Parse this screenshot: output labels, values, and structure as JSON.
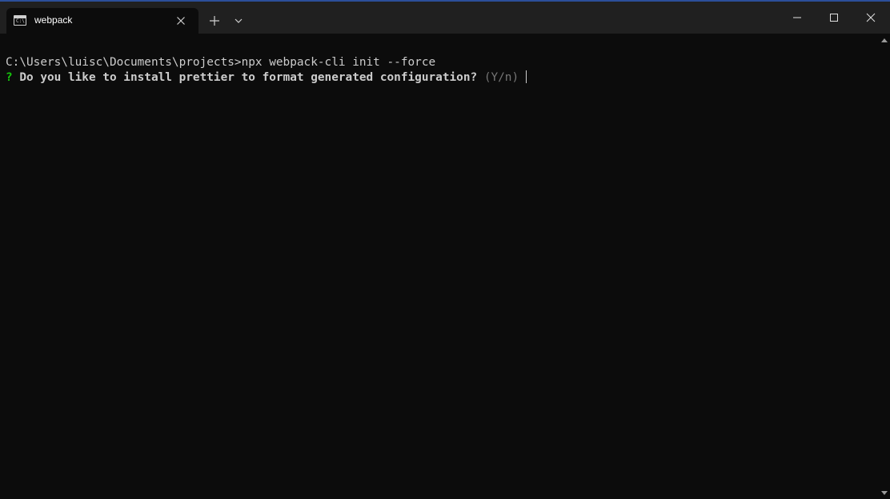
{
  "window": {
    "tab_title": "webpack",
    "tab_icon": "terminal-icon",
    "colors": {
      "titlebar": "#202020",
      "background": "#0c0c0c",
      "text": "#cccccc",
      "prompt_marker": "#16c60c",
      "hint": "#767676"
    }
  },
  "titlebar_controls": {
    "new_tab_icon": "plus-icon",
    "dropdown_icon": "chevron-down-icon",
    "minimize_icon": "minimize-icon",
    "maximize_icon": "maximize-icon",
    "close_icon": "close-icon"
  },
  "terminal": {
    "command_line": "C:\\Users\\luisc\\Documents\\projects>npx webpack-cli init --force",
    "question_marker": "?",
    "question_text": " Do you like to install prettier to format generated configuration?",
    "question_hint": " (Y/n) "
  }
}
